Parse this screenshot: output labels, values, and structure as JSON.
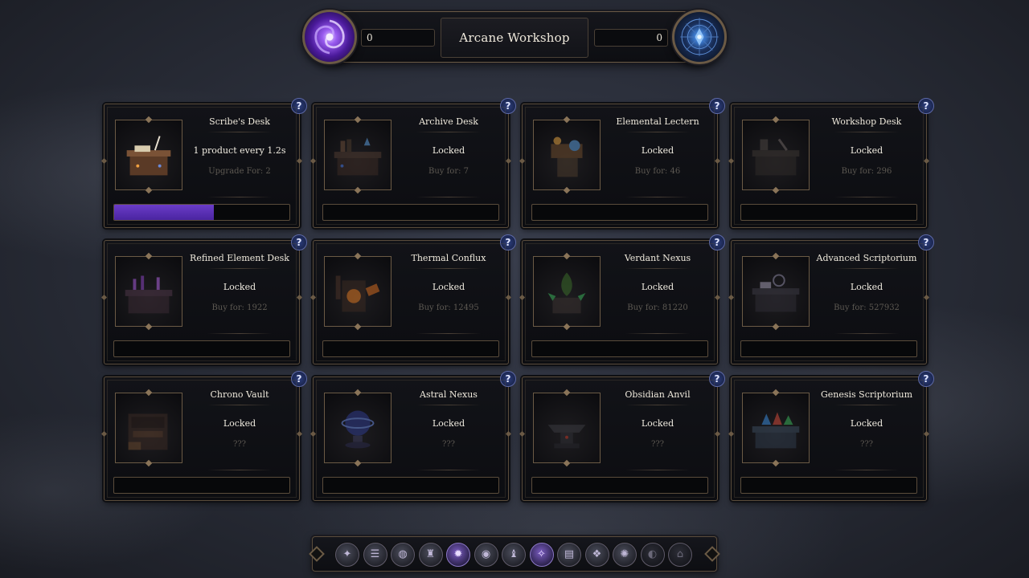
{
  "header": {
    "title": "Arcane Workshop",
    "left_counter": "0",
    "right_counter": "0",
    "left_orb_icon": "purple-vortex-orb",
    "right_orb_icon": "blue-astral-compass-orb"
  },
  "cards": [
    {
      "name": "Scribe's Desk",
      "status": "1 product every 1.2s",
      "price": "Upgrade For: 2",
      "progress": 0.57,
      "icon": "scribes-desk"
    },
    {
      "name": "Archive Desk",
      "status": "Locked",
      "price": "Buy for: 7",
      "progress": 0,
      "icon": "archive-desk"
    },
    {
      "name": "Elemental Lectern",
      "status": "Locked",
      "price": "Buy for: 46",
      "progress": 0,
      "icon": "elemental-lectern"
    },
    {
      "name": "Workshop Desk",
      "status": "Locked",
      "price": "Buy for: 296",
      "progress": 0,
      "icon": "workshop-desk"
    },
    {
      "name": "Refined Element Desk",
      "status": "Locked",
      "price": "Buy for: 1922",
      "progress": 0,
      "icon": "refined-element-desk"
    },
    {
      "name": "Thermal Conflux",
      "status": "Locked",
      "price": "Buy for: 12495",
      "progress": 0,
      "icon": "thermal-conflux"
    },
    {
      "name": "Verdant Nexus",
      "status": "Locked",
      "price": "Buy for: 81220",
      "progress": 0,
      "icon": "verdant-nexus"
    },
    {
      "name": "Advanced Scriptorium",
      "status": "Locked",
      "price": "Buy for: 527932",
      "progress": 0,
      "icon": "advanced-scriptorium"
    },
    {
      "name": "Chrono Vault",
      "status": "Locked",
      "price": "???",
      "progress": 0,
      "icon": "chrono-vault"
    },
    {
      "name": "Astral Nexus",
      "status": "Locked",
      "price": "???",
      "progress": 0,
      "icon": "astral-nexus"
    },
    {
      "name": "Obsidian Anvil",
      "status": "Locked",
      "price": "???",
      "progress": 0,
      "icon": "obsidian-anvil"
    },
    {
      "name": "Genesis Scriptorium",
      "status": "Locked",
      "price": "???",
      "progress": 0,
      "icon": "genesis-scriptorium"
    }
  ],
  "help_label": "?",
  "nav": {
    "buttons": [
      {
        "icon": "crystal-icon",
        "glyph": "✦",
        "state": "normal"
      },
      {
        "icon": "scroll-icon",
        "glyph": "☰",
        "state": "normal"
      },
      {
        "icon": "planet-icon",
        "glyph": "◍",
        "state": "normal"
      },
      {
        "icon": "tower-icon",
        "glyph": "♜",
        "state": "normal"
      },
      {
        "icon": "flame-icon",
        "glyph": "✹",
        "state": "active"
      },
      {
        "icon": "eye-icon",
        "glyph": "◉",
        "state": "normal"
      },
      {
        "icon": "spire-icon",
        "glyph": "♝",
        "state": "normal"
      },
      {
        "icon": "star-icon",
        "glyph": "✧",
        "state": "active"
      },
      {
        "icon": "tome-icon",
        "glyph": "▤",
        "state": "normal"
      },
      {
        "icon": "rune-icon",
        "glyph": "❖",
        "state": "normal"
      },
      {
        "icon": "compass-icon",
        "glyph": "✺",
        "state": "normal"
      },
      {
        "icon": "moon-icon",
        "glyph": "◐",
        "state": "dim"
      },
      {
        "icon": "gate-icon",
        "glyph": "⌂",
        "state": "dim"
      }
    ]
  },
  "colors": {
    "accent_purple": "#6a3cc8",
    "border_bronze": "#6b5a45",
    "help_blue": "#2d3f7e"
  }
}
